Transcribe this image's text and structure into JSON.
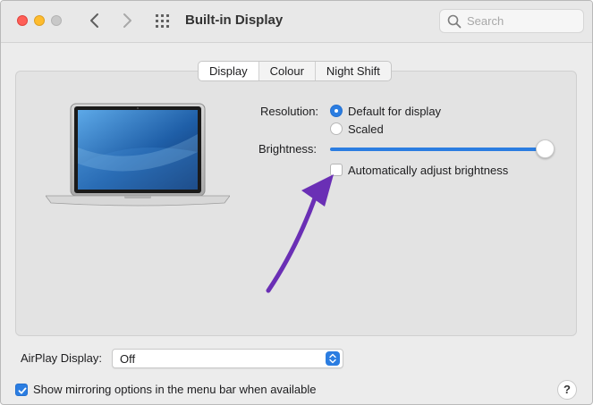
{
  "window": {
    "title": "Built-in Display",
    "search_placeholder": "Search"
  },
  "tabs": [
    {
      "label": "Display",
      "active": true
    },
    {
      "label": "Colour",
      "active": false
    },
    {
      "label": "Night Shift",
      "active": false
    }
  ],
  "resolution": {
    "label": "Resolution:",
    "options": [
      {
        "label": "Default for display",
        "selected": true
      },
      {
        "label": "Scaled",
        "selected": false
      }
    ]
  },
  "brightness": {
    "label": "Brightness:",
    "level_fraction": 1.0,
    "auto_adjust_label": "Automatically adjust brightness",
    "auto_adjust_checked": false
  },
  "airplay": {
    "label": "AirPlay Display:",
    "selected_value": "Off"
  },
  "mirroring": {
    "label": "Show mirroring options in the menu bar when available",
    "checked": true
  },
  "help": {
    "label": "?"
  },
  "colors": {
    "accent": "#2b7de1",
    "annotation_arrow": "#6a2fb5",
    "close": "#fe5f57",
    "minimize": "#febc2e"
  },
  "icons": {
    "back": "chevron-left-icon",
    "forward": "chevron-right-icon",
    "grid": "grid-icon",
    "search": "search-icon",
    "laptop": "laptop-icon",
    "arrow": "annotation-arrow-icon",
    "stepper": "up-down-chevron-icon"
  }
}
